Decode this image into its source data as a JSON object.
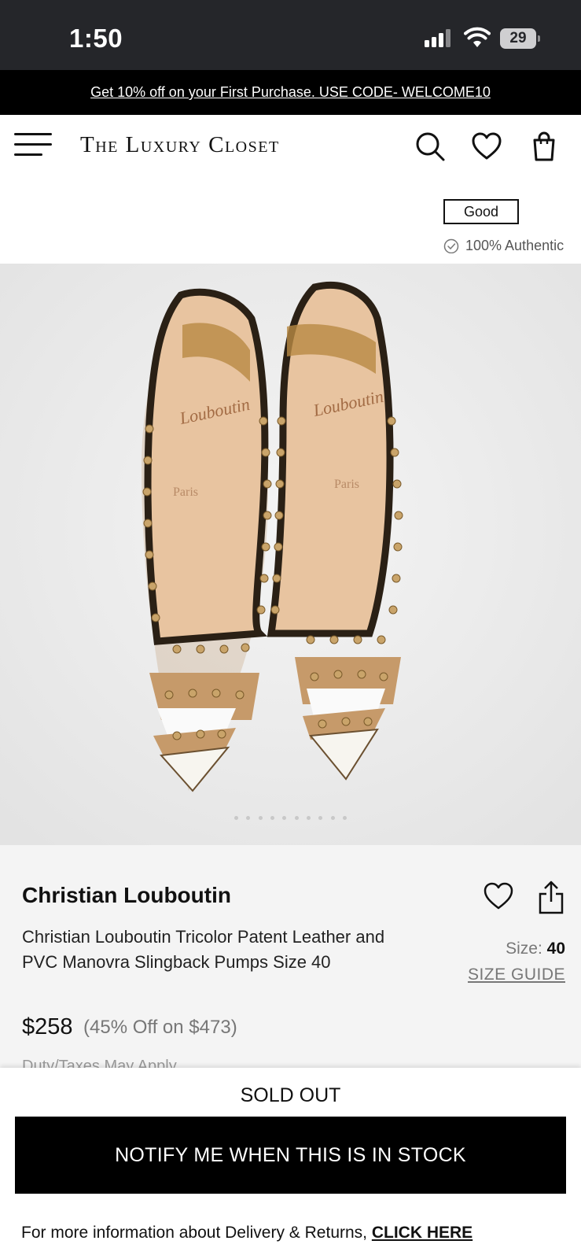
{
  "status_bar": {
    "time": "1:50",
    "battery": "29"
  },
  "promo": {
    "text": "Get 10% off on your First Purchase. USE CODE- WELCOME10"
  },
  "header": {
    "logo": "The Luxury Closet",
    "icons": [
      "menu-icon",
      "search-icon",
      "heart-icon",
      "bag-icon"
    ]
  },
  "condition": {
    "badge": "Good",
    "authentic": "100% Authentic"
  },
  "gallery": {
    "image_count": 10,
    "active_index": 0
  },
  "product": {
    "brand": "Christian Louboutin",
    "title": "Christian Louboutin Tricolor Patent Leather and PVC Manovra Slingback Pumps Size 40",
    "size_label": "Size: ",
    "size_value": "40",
    "size_guide": "SIZE GUIDE",
    "price": "$258",
    "discount": "(45% Off on $473)",
    "duty": "Duty/Taxes May Apply"
  },
  "bottom": {
    "sold_out": "SOLD OUT",
    "notify_button": "NOTIFY ME WHEN THIS IS IN STOCK",
    "info_text": "For more information about Delivery & Returns, ",
    "info_link": "CLICK HERE"
  },
  "colors": {
    "promo_bg": "#000000",
    "status_bg": "#25262a",
    "image_bg": "#ebebeb",
    "details_bg": "#f4f4f4",
    "button_bg": "#000000"
  }
}
